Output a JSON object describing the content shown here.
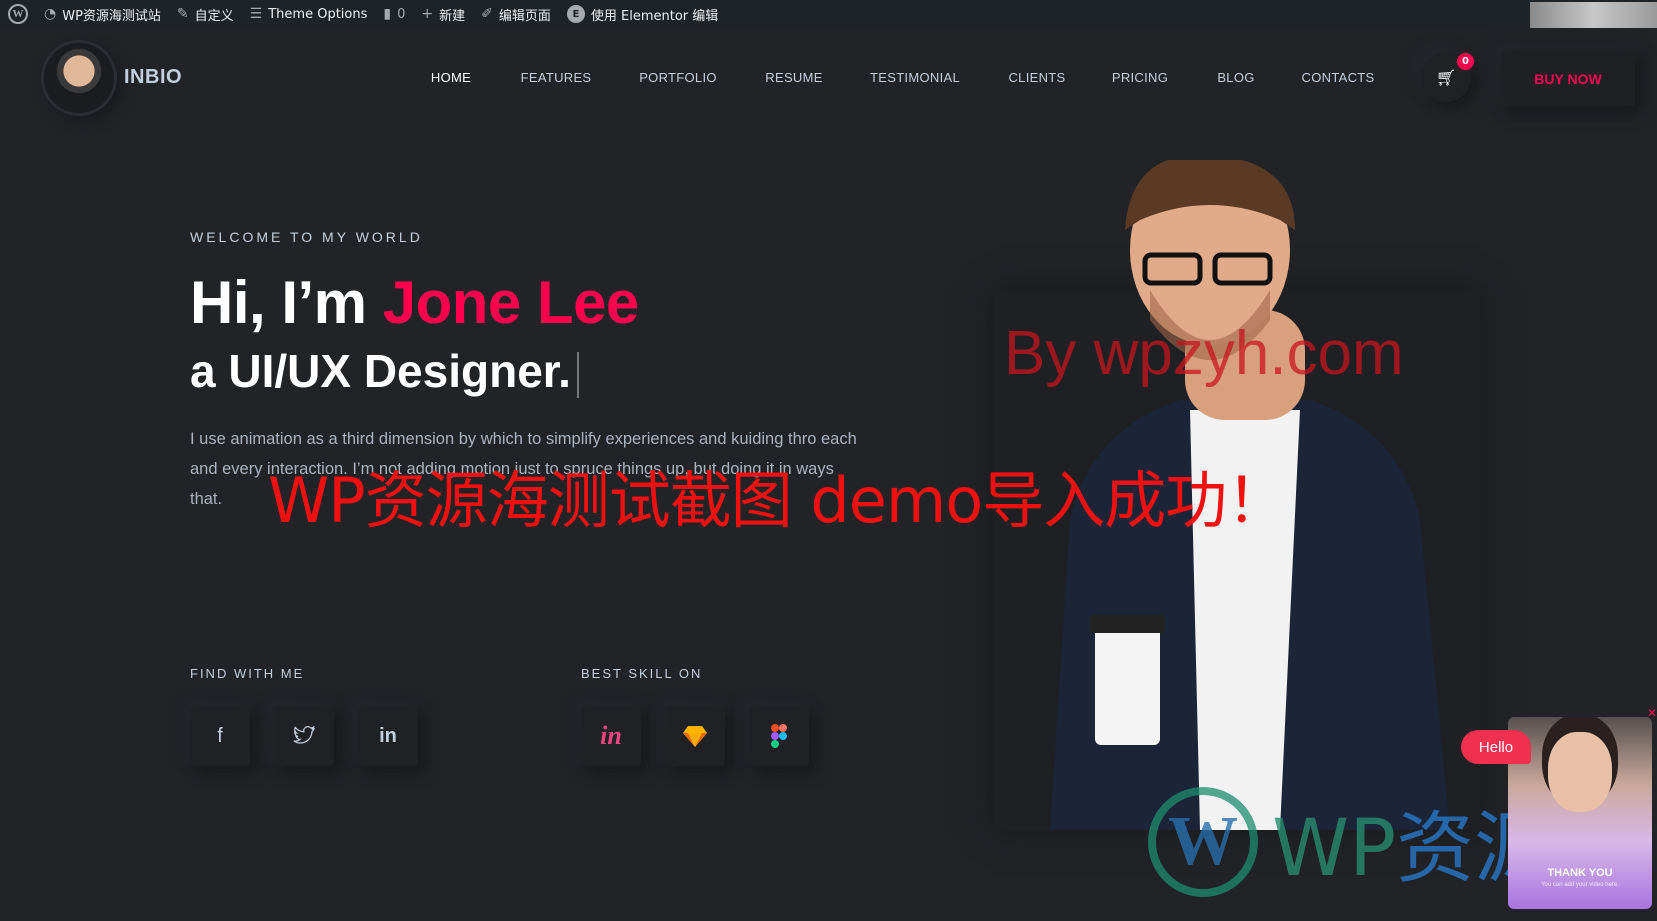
{
  "admin_bar": {
    "site_name": "WP资源海测试站",
    "customize": "自定义",
    "theme_options": "Theme Options",
    "comments_count": "0",
    "new": "新建",
    "edit_page": "编辑页面",
    "elementor_edit": "使用 Elementor 编辑"
  },
  "header": {
    "brand": "INBIO",
    "nav": [
      "HOME",
      "FEATURES",
      "PORTFOLIO",
      "RESUME",
      "TESTIMONIAL",
      "CLIENTS",
      "PRICING",
      "BLOG",
      "CONTACTS"
    ],
    "cart_count": "0",
    "buy_now": "BUY NOW"
  },
  "hero": {
    "welcome": "WELCOME TO MY WORLD",
    "greeting": "Hi, I’m ",
    "name": "Jone Lee",
    "role": "a UI/UX Designer.",
    "description": "I use animation as a third dimension by which to simplify experiences and kuiding thro each and every interaction. I’m not adding motion just to spruce things up, but doing it in ways that.",
    "find_with_me": "FIND WITH ME",
    "best_skill_on": "BEST SKILL ON",
    "social_icons": [
      "facebook-icon",
      "twitter-icon",
      "linkedin-icon"
    ],
    "skill_icons": [
      "invision-icon",
      "sketch-icon",
      "figma-icon"
    ]
  },
  "watermarks": {
    "by_site": "By wpzyh.com",
    "import_success": "WP资源海测试截图 demo导入成功！",
    "logo_latin": "WP",
    "logo_cn": "资源海"
  },
  "video_popup": {
    "hello": "Hello",
    "title": "THANK YOU",
    "subtitle": "You can add your video here."
  },
  "colors": {
    "accent": "#ff014f",
    "background": "#212327",
    "admin_bar": "#1d2327"
  }
}
